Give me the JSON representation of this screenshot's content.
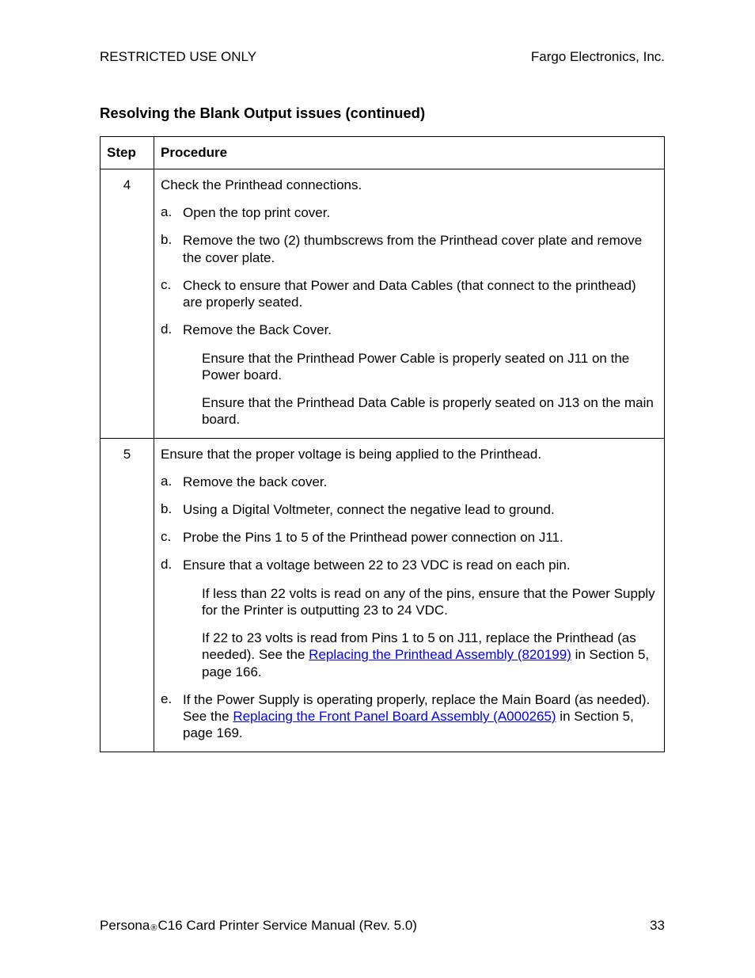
{
  "header": {
    "left": "RESTRICTED USE ONLY",
    "right": "Fargo Electronics, Inc."
  },
  "section_title": "Resolving the Blank Output issues (continued)",
  "table": {
    "col_step": "Step",
    "col_procedure": "Procedure"
  },
  "rows": {
    "r4": {
      "num": "4",
      "lead": "Check the Printhead connections.",
      "a_mark": "a.",
      "a": "Open the top print cover.",
      "b_mark": "b.",
      "b": "Remove the two (2) thumbscrews from the Printhead cover plate and remove the cover plate.",
      "c_mark": "c.",
      "c": "Check to ensure that Power and Data Cables (that connect to the printhead) are properly seated.",
      "d_mark": "d.",
      "d": "Remove the Back Cover.",
      "d_sub1": "Ensure that the Printhead Power Cable is properly seated on J11 on the Power board.",
      "d_sub2": "Ensure that the Printhead Data Cable is properly seated on J13 on the main board."
    },
    "r5": {
      "num": "5",
      "lead": "Ensure that the proper voltage is being applied to the Printhead.",
      "a_mark": "a.",
      "a": "Remove the back cover.",
      "b_mark": "b.",
      "b": "Using a Digital Voltmeter, connect the negative lead to ground.",
      "c_mark": "c.",
      "c": "Probe the Pins 1 to 5 of the Printhead power connection on J11.",
      "d_mark": "d.",
      "d": "Ensure that a voltage between 22 to 23 VDC is read on each pin.",
      "d_sub1": "If less than 22 volts is read on any of the pins, ensure that the Power Supply for the Printer is outputting 23 to 24 VDC.",
      "d_sub2_pre": "If 22 to 23 volts is read from Pins 1 to 5 on J11, replace the Printhead (as needed). See the ",
      "d_sub2_link": "Replacing the Printhead Assembly (820199)",
      "d_sub2_post": " in Section 5, page 166.",
      "e_mark": "e.",
      "e_pre": "If the Power Supply is operating properly, replace the Main Board (as needed). See the ",
      "e_link": "Replacing the Front Panel Board Assembly (A000265)",
      "e_post": " in Section 5, page 169."
    }
  },
  "footer": {
    "brand": "Persona",
    "tail": " C16 Card Printer Service Manual (Rev. 5.0)",
    "pagenum": "33"
  }
}
